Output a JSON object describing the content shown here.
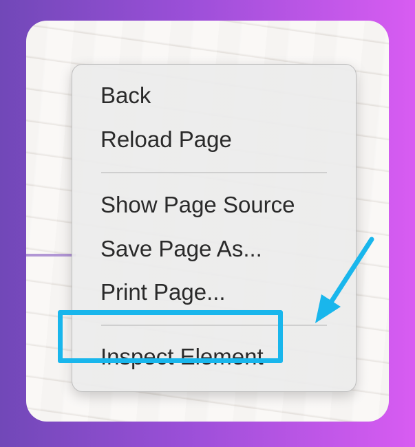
{
  "context_menu": {
    "items": [
      {
        "label": "Back"
      },
      {
        "label": "Reload Page"
      },
      {
        "label": "Show Page Source"
      },
      {
        "label": "Save Page As..."
      },
      {
        "label": "Print Page..."
      },
      {
        "label": "Inspect Element"
      }
    ]
  },
  "annotation": {
    "highlight_color": "#19b6ec",
    "arrow_icon": "arrow-pointing-down-left-icon",
    "highlighted_item": "Inspect Element"
  },
  "colors": {
    "background_gradient_start": "#7148b8",
    "background_gradient_end": "#d85cf2",
    "menu_background": "#ececec",
    "menu_text": "#2a2a2a"
  }
}
